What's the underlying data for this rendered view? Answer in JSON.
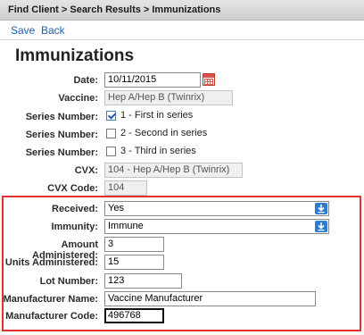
{
  "breadcrumb": "Find Client > Search Results > Immunizations",
  "actions": {
    "save": "Save",
    "back": "Back"
  },
  "title": "Immunizations",
  "form": {
    "date": {
      "label": "Date:",
      "value": "10/11/2015"
    },
    "vaccine": {
      "label": "Vaccine:",
      "value": "Hep A/Hep B (Twinrix)"
    },
    "series": [
      {
        "label": "Series Number:",
        "text": "1 - First in series",
        "checked": true
      },
      {
        "label": "Series Number:",
        "text": "2 - Second in series",
        "checked": false
      },
      {
        "label": "Series Number:",
        "text": "3 - Third in series",
        "checked": false
      }
    ],
    "cvx": {
      "label": "CVX:",
      "value": "104 - Hep A/Hep B (Twinrix)"
    },
    "cvx_code": {
      "label": "CVX Code:",
      "value": "104"
    },
    "received": {
      "label": "Received:",
      "value": "Yes"
    },
    "immunity": {
      "label": "Immunity:",
      "value": "Immune"
    },
    "amount": {
      "label": "Amount Administered:",
      "value": "3"
    },
    "units": {
      "label": "Units Administered:",
      "value": "15"
    },
    "lot": {
      "label": "Lot Number:",
      "value": "123"
    },
    "manufacturer_name": {
      "label": "Manufacturer Name:",
      "value": "Vaccine Manufacturer"
    },
    "manufacturer_code": {
      "label": "Manufacturer Code:",
      "value": "496768"
    }
  },
  "colors": {
    "link": "#1f5fb8",
    "highlight": "#e03030",
    "dropdown": "#2d7dd2"
  }
}
